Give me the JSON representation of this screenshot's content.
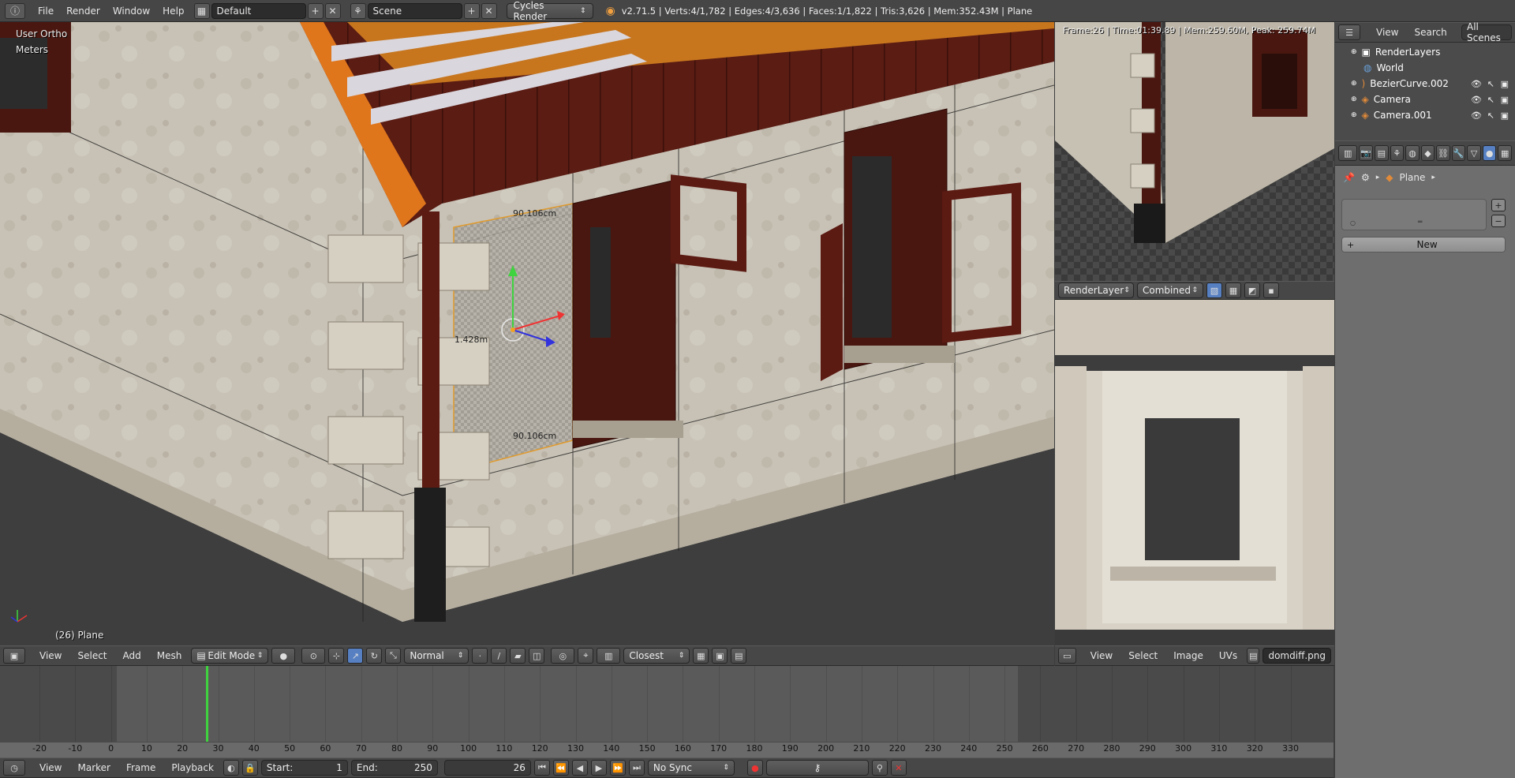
{
  "topbar": {
    "menus": [
      "File",
      "Render",
      "Window",
      "Help"
    ],
    "layout": "Default",
    "scene": "Scene",
    "engine": "Cycles Render",
    "stats": "v2.71.5 | Verts:4/1,782 | Edges:4/3,636 | Faces:1/1,822 | Tris:3,626 | Mem:352.43M | Plane"
  },
  "viewport": {
    "view_name": "User Ortho",
    "units": "Meters",
    "object_info": "(26) Plane",
    "dim_top": "90.106cm",
    "dim_bottom": "90.106cm",
    "dim_side": "1.428m"
  },
  "viewport_header": {
    "menus": [
      "View",
      "Select",
      "Add",
      "Mesh"
    ],
    "mode": "Edit Mode",
    "orientation": "Normal",
    "snap": "Closest"
  },
  "render_preview": {
    "info": "Frame:26 | Time:01:39.89 | Mem:259.60M, Peak: 259.74M",
    "layer": "RenderLayer",
    "pass": "Combined"
  },
  "image_editor_header": {
    "menus": [
      "View",
      "Select",
      "Image",
      "UVs"
    ],
    "image_name": "domdiff.png"
  },
  "outliner": {
    "menus": [
      "View",
      "Search"
    ],
    "filter": "All Scenes",
    "items": [
      {
        "name": "RenderLayers"
      },
      {
        "name": "World"
      },
      {
        "name": "BezierCurve.002"
      },
      {
        "name": "Camera"
      },
      {
        "name": "Camera.001"
      }
    ]
  },
  "properties": {
    "context_object": "Plane",
    "new_label": "New"
  },
  "timeline": {
    "menus": [
      "View",
      "Marker",
      "Frame",
      "Playback"
    ],
    "start_label": "Start:",
    "start_value": "1",
    "end_label": "End:",
    "end_value": "250",
    "current_frame": "26",
    "sync": "No Sync",
    "ticks": [
      "-20",
      "-10",
      "0",
      "10",
      "20",
      "30",
      "40",
      "50",
      "60",
      "70",
      "80",
      "90",
      "100",
      "110",
      "120",
      "130",
      "140",
      "150",
      "160",
      "170",
      "180",
      "190",
      "200",
      "210",
      "220",
      "230",
      "240",
      "250",
      "260",
      "270",
      "280",
      "290",
      "300",
      "310",
      "320",
      "330"
    ]
  },
  "colors": {
    "accent": "#5680c2",
    "wall": "#c9c3b8",
    "shutter": "#4a1a12",
    "roof": "#5b1d14",
    "playhead": "#3fd33f"
  }
}
